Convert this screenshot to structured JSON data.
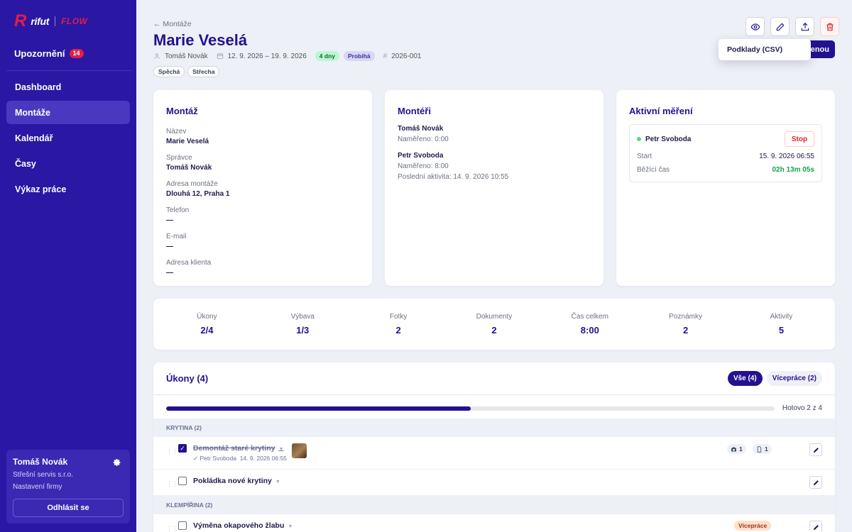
{
  "brand": {
    "logo_r": "R",
    "logo_name": "rifut",
    "logo_product": "FLOW",
    "accent_red": "#e11d48",
    "sidebar_bg": "#2a17a3"
  },
  "sidebar": {
    "notifications": {
      "label": "Upozornění",
      "count": "14"
    },
    "items": [
      {
        "label": "Dashboard",
        "active": false
      },
      {
        "label": "Montáže",
        "active": true
      },
      {
        "label": "Kalendář",
        "active": false
      },
      {
        "label": "Časy",
        "active": false
      },
      {
        "label": "Výkaz práce",
        "active": false
      }
    ],
    "user": {
      "name": "Tomáš Novák",
      "company": "Střešní servis s.r.o.",
      "settings_label": "Nastavení firmy",
      "logout_label": "Odhlásit se",
      "icon": "gear-icon"
    }
  },
  "header": {
    "back_label": "← Montáže",
    "title": "Marie Veselá",
    "manager": "Tomáš Novák",
    "date_range": "12. 9. 2026 – 19. 9. 2026",
    "duration_badge": "4 dny",
    "status_badge": "Probíhá",
    "job_number": "2026-001",
    "tags": [
      "Spěchá",
      "Střecha"
    ],
    "hidden_button_label": "enou",
    "dropdown_item": "Podklady (CSV)",
    "actions": [
      "eye-icon",
      "edit-icon",
      "upload-icon",
      "trash-icon"
    ]
  },
  "montaz_card": {
    "title": "Montáž",
    "fields": [
      {
        "label": "Název",
        "value": "Marie Veselá"
      },
      {
        "label": "Správce",
        "value": "Tomáš Novák"
      },
      {
        "label": "Adresa montáže",
        "value": "Dlouhá 12, Praha 1"
      },
      {
        "label": "Telefon",
        "value": "—"
      },
      {
        "label": "E-mail",
        "value": "—"
      },
      {
        "label": "Adresa klienta",
        "value": "—"
      }
    ]
  },
  "workers_card": {
    "title": "Montéři",
    "workers": [
      {
        "name": "Tomáš Novák",
        "measured": "Naměřeno: 0:00",
        "last_activity": ""
      },
      {
        "name": "Petr Svoboda",
        "measured": "Naměřeno: 8:00",
        "last_activity": "Poslední aktivita: 14. 9. 2026 10:55"
      }
    ]
  },
  "active_card": {
    "title": "Aktivní měření",
    "worker": "Petr Svoboda",
    "stop_label": "Stop",
    "start_label": "Start",
    "start_value": "15. 9. 2026 06:55",
    "running_label": "Běžící čas",
    "running_value": "02h 13m 05s"
  },
  "stats": [
    {
      "label": "Úkony",
      "value": "2/4"
    },
    {
      "label": "Výbava",
      "value": "1/3"
    },
    {
      "label": "Fotky",
      "value": "2"
    },
    {
      "label": "Dokumenty",
      "value": "2"
    },
    {
      "label": "Čas celkem",
      "value": "8:00"
    },
    {
      "label": "Poznámky",
      "value": "2"
    },
    {
      "label": "Aktivity",
      "value": "5"
    }
  ],
  "tasks": {
    "title": "Úkony (4)",
    "filter_all": "Vše (4)",
    "filter_extra": "Vícepráce (2)",
    "progress_fraction": 0.5,
    "progress_label": "Hotovo 2 z 4",
    "groups": [
      {
        "label": "KRYTINA (2)",
        "items": [
          {
            "name": "Demontáž staré krytiny",
            "done": true,
            "done_by": "✓ Petr Svoboda",
            "done_at": "14. 9. 2026 06:55",
            "photos": "1",
            "docs": "1"
          },
          {
            "name": "Pokládka nové krytiny",
            "done": false
          }
        ]
      },
      {
        "label": "KLEMPÍŘINA (2)",
        "items": [
          {
            "name": "Výměna okapového žlabu",
            "done": false,
            "badge": "Vícepráce"
          }
        ]
      }
    ]
  }
}
